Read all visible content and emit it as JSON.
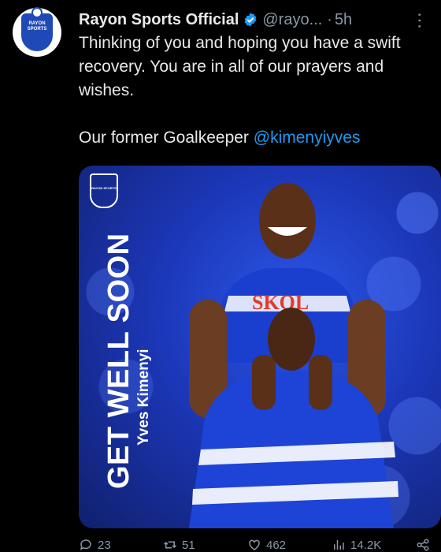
{
  "avatar": {
    "text": "RAYON SPORTS"
  },
  "post": {
    "display_name": "Rayon Sports Official",
    "handle": "@rayo...",
    "separator": "·",
    "time": "5h",
    "text_line1": "Thinking of you and hoping you have a swift recovery. You are in all of our prayers and wishes.",
    "text_line2_prefix": "Our former Goalkeeper ",
    "mention": "@kimenyiyves"
  },
  "media": {
    "logo_text": "RAYON SPORTS",
    "title": "GET WELL SOON",
    "subtitle": "Yves Kimenyi",
    "jersey_text": "SKOL"
  },
  "actions": {
    "replies": "23",
    "reposts": "51",
    "likes": "462",
    "views": "14.2K"
  },
  "colors": {
    "background": "#000000",
    "accent": "#1d9bf0",
    "muted": "#8b98a5",
    "club_blue": "#1f49b6"
  },
  "icons": [
    "verified-badge-icon",
    "more-icon",
    "reply-icon",
    "repost-icon",
    "like-icon",
    "views-icon",
    "share-icon"
  ]
}
